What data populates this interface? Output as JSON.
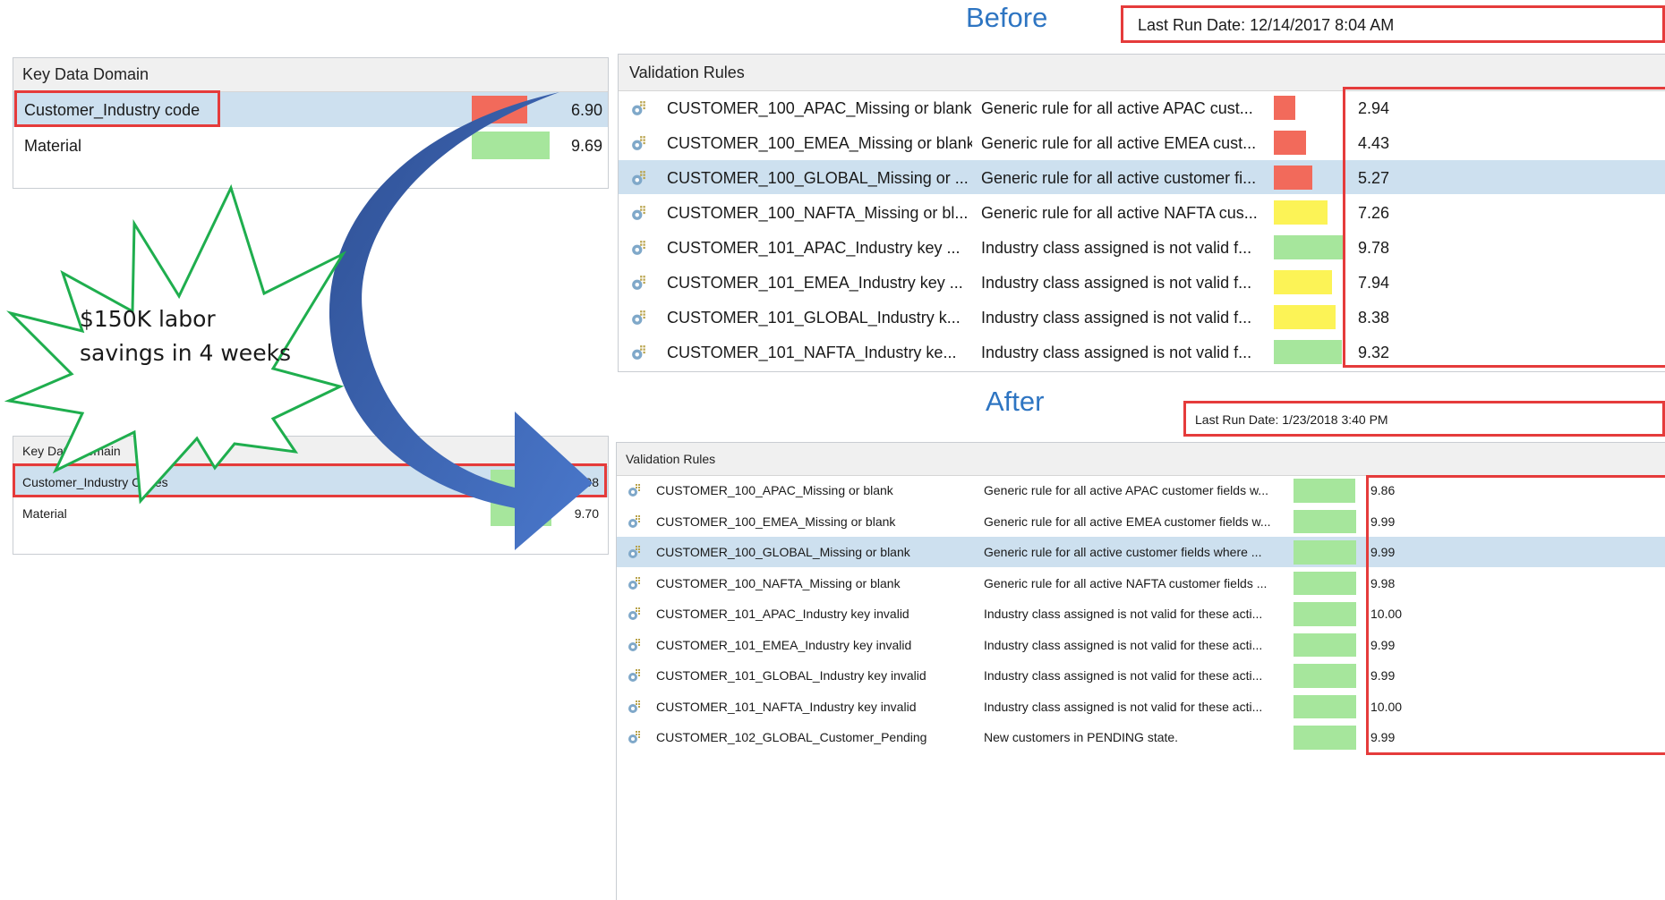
{
  "labels": {
    "before": "Before",
    "after": "After"
  },
  "before": {
    "last_run": "Last Run Date:  12/14/2017 8:04 AM",
    "kdd": {
      "header": "Key Data Domain",
      "rows": [
        {
          "name": "Customer_Industry code",
          "value": "6.90",
          "score": 6.9,
          "color": "#f26a5b"
        },
        {
          "name": "Material",
          "value": "9.69",
          "score": 9.69,
          "color": "#a6e69c"
        }
      ]
    },
    "rules": {
      "header": "Validation Rules",
      "rows": [
        {
          "name": "CUSTOMER_100_APAC_Missing or blank",
          "desc": "Generic rule for all active APAC  cust...",
          "value": "2.94",
          "score": 2.94,
          "color": "#f26a5b"
        },
        {
          "name": "CUSTOMER_100_EMEA_Missing or blank",
          "desc": "Generic rule for all active EMEA  cust...",
          "value": "4.43",
          "score": 4.43,
          "color": "#f26a5b"
        },
        {
          "name": "CUSTOMER_100_GLOBAL_Missing or ...",
          "desc": "Generic rule for all active customer fi...",
          "value": "5.27",
          "score": 5.27,
          "color": "#f26a5b"
        },
        {
          "name": "CUSTOMER_100_NAFTA_Missing or bl...",
          "desc": "Generic rule for all active NAFTA  cus...",
          "value": "7.26",
          "score": 7.26,
          "color": "#fcf356"
        },
        {
          "name": "CUSTOMER_101_APAC_Industry key ...",
          "desc": "Industry class assigned is not valid f...",
          "value": "9.78",
          "score": 9.78,
          "color": "#a6e69c"
        },
        {
          "name": "CUSTOMER_101_EMEA_Industry key ...",
          "desc": "Industry class assigned is not valid f...",
          "value": "7.94",
          "score": 7.94,
          "color": "#fcf356"
        },
        {
          "name": "CUSTOMER_101_GLOBAL_Industry k...",
          "desc": "Industry class assigned is not valid f...",
          "value": "8.38",
          "score": 8.38,
          "color": "#fcf356"
        },
        {
          "name": "CUSTOMER_101_NAFTA_Industry ke...",
          "desc": "Industry class assigned is not valid f...",
          "value": "9.32",
          "score": 9.32,
          "color": "#a6e69c"
        }
      ]
    }
  },
  "after": {
    "last_run": "Last Run Date:  1/23/2018 3:40 PM",
    "kdd": {
      "header": "Key Data Domain",
      "rows": [
        {
          "name": "Customer_Industry Codes",
          "value": "9.98",
          "score": 9.98,
          "color": "#a6e69c"
        },
        {
          "name": "Material",
          "value": "9.70",
          "score": 9.7,
          "color": "#a6e69c"
        }
      ]
    },
    "rules": {
      "header": "Validation Rules",
      "rows": [
        {
          "name": "CUSTOMER_100_APAC_Missing or blank",
          "desc": "Generic rule for all active APAC  customer fields w...",
          "value": "9.86",
          "score": 9.86,
          "color": "#a6e69c"
        },
        {
          "name": "CUSTOMER_100_EMEA_Missing or blank",
          "desc": "Generic rule for all active EMEA  customer fields w...",
          "value": "9.99",
          "score": 9.99,
          "color": "#a6e69c"
        },
        {
          "name": "CUSTOMER_100_GLOBAL_Missing or blank",
          "desc": "Generic rule for all active customer fields where  ...",
          "value": "9.99",
          "score": 9.99,
          "color": "#a6e69c"
        },
        {
          "name": "CUSTOMER_100_NAFTA_Missing or blank",
          "desc": "Generic rule for all active NAFTA  customer fields ...",
          "value": "9.98",
          "score": 9.98,
          "color": "#a6e69c"
        },
        {
          "name": "CUSTOMER_101_APAC_Industry key invalid",
          "desc": "Industry class assigned is not valid for these acti...",
          "value": "10.00",
          "score": 10.0,
          "color": "#a6e69c"
        },
        {
          "name": "CUSTOMER_101_EMEA_Industry key invalid",
          "desc": "Industry class assigned is not valid for these acti...",
          "value": "9.99",
          "score": 9.99,
          "color": "#a6e69c"
        },
        {
          "name": "CUSTOMER_101_GLOBAL_Industry key invalid",
          "desc": "Industry class assigned is not valid for these acti...",
          "value": "9.99",
          "score": 9.99,
          "color": "#a6e69c"
        },
        {
          "name": "CUSTOMER_101_NAFTA_Industry key invalid",
          "desc": "Industry class assigned is not valid for these acti...",
          "value": "10.00",
          "score": 10.0,
          "color": "#a6e69c"
        },
        {
          "name": "CUSTOMER_102_GLOBAL_Customer_Pending",
          "desc": "New customers in PENDING state.",
          "value": "9.99",
          "score": 9.99,
          "color": "#a6e69c"
        }
      ]
    }
  },
  "callout": {
    "line1": "$150K labor",
    "line2": "savings  in 4 weeks"
  },
  "colors": {
    "highlight": "#e53b3b",
    "accent_blue": "#2e75c2",
    "arrow": "#3b66b6",
    "star": "#1fae4e"
  }
}
